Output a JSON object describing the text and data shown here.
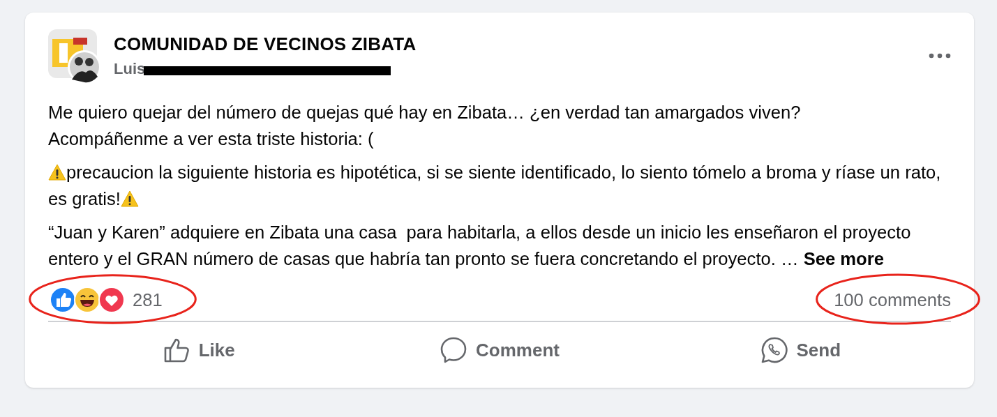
{
  "post": {
    "group_name": "COMUNIDAD DE VECINOS ZIBATA",
    "author": "Luis",
    "author_redacted": true,
    "paragraphs": [
      [
        {
          "kind": "text",
          "text": "Me quiero quejar del número de quejas qué hay en Zibata… ¿en verdad tan amargados viven?\nAcompáñenme a ver esta triste historia: ("
        }
      ],
      [
        {
          "kind": "warning"
        },
        {
          "kind": "text",
          "text": "precaucion la siguiente historia es hipotética, si se siente identificado, lo siento tómelo a broma y ríase un rato, es gratis!"
        },
        {
          "kind": "warning"
        }
      ],
      [
        {
          "kind": "text",
          "text": "“Juan y Karen” adquiere en Zibata una casa  para habitarla, a ellos desde un inicio les enseñaron el proyecto entero y el GRAN número de casas que habría tan pronto se fuera concretando el proyecto. … "
        },
        {
          "kind": "link",
          "text": "See more"
        }
      ]
    ],
    "reactions": [
      {
        "kind": "like"
      },
      {
        "kind": "haha"
      },
      {
        "kind": "love"
      }
    ],
    "reaction_count": "281",
    "reaction_count_circled": true,
    "comments": "100 comments",
    "comments_circled": true,
    "actions": [
      {
        "kind": "like",
        "label": "Like"
      },
      {
        "kind": "comment",
        "label": "Comment"
      },
      {
        "kind": "send",
        "label": "Send"
      }
    ]
  }
}
